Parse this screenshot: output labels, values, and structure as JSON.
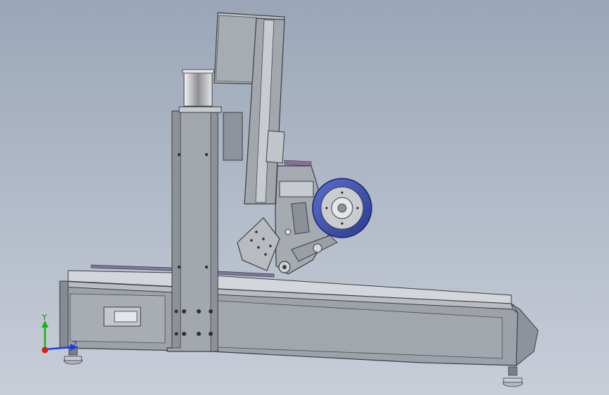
{
  "viewport": {
    "background_top": "#9aa6b8",
    "background_bottom": "#c8ced8"
  },
  "colors": {
    "steel_light": "#c9ccd2",
    "steel_mid": "#9fa3ab",
    "steel_dark": "#6f737a",
    "edge": "#3b3d42",
    "roller_blue": "#3d4fb0",
    "triad_x": "#e01b1b",
    "triad_y": "#16b316",
    "triad_z": "#1b3fe0",
    "tape_accent": "#8a6e9a"
  },
  "triad": {
    "y_label": "Y",
    "z_label": "Z"
  }
}
